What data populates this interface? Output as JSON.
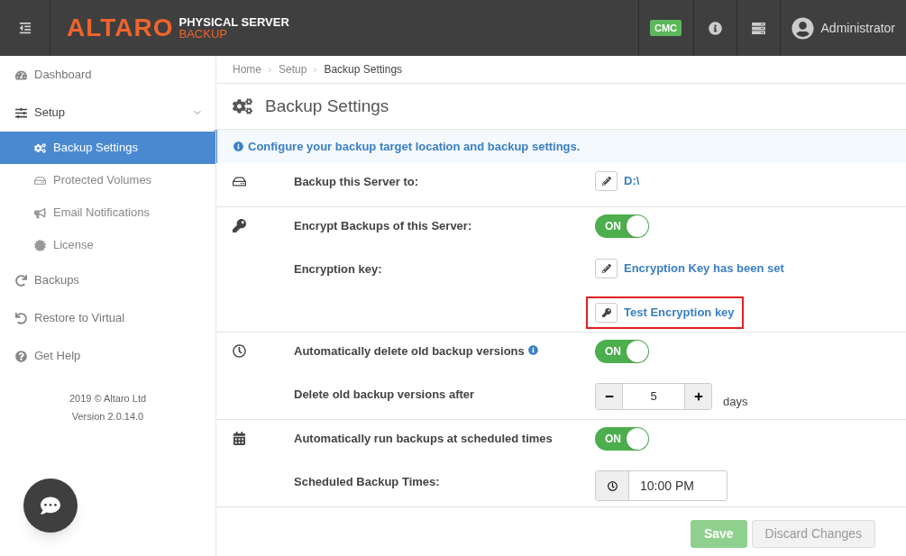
{
  "header": {
    "logo": {
      "wordmark": "ALTARO",
      "line_1": "PHYSICAL SERVER",
      "line_2": "BACKUP"
    },
    "badge": "CMC",
    "user": "Administrator"
  },
  "sidebar": {
    "items": [
      {
        "label": "Dashboard",
        "selected": false
      },
      {
        "label": "Setup",
        "selected": false,
        "expanded": true,
        "children": [
          {
            "label": "Backup Settings",
            "selected": true
          },
          {
            "label": "Protected Volumes",
            "selected": false
          },
          {
            "label": "Email Notifications",
            "selected": false
          },
          {
            "label": "License",
            "selected": false
          }
        ]
      },
      {
        "label": "Backups",
        "selected": false
      },
      {
        "label": "Restore to Virtual",
        "selected": false
      },
      {
        "label": "Get Help",
        "selected": false
      }
    ],
    "footer": [
      "2019 © Altaro Ltd",
      "Version 2.0.14.0"
    ]
  },
  "breadcrumb": [
    "Home",
    "Setup",
    "Backup Settings"
  ],
  "page_title": "Backup Settings",
  "info_message": "Configure your backup target location and backup settings.",
  "sections": [
    {
      "rows": [
        {
          "kind": "link",
          "label": "Backup this Server to:",
          "value": "D:\\",
          "highlighted": false
        }
      ]
    },
    {
      "rows": [
        {
          "kind": "toggle",
          "label": "Encrypt Backups of this Server:",
          "on": true,
          "state_label": "ON"
        },
        {
          "kind": "link",
          "label": "Encryption key:",
          "value": "Encryption Key has been set",
          "highlighted": false
        },
        {
          "kind": "key_link",
          "value": "Test Encryption key",
          "highlighted": true
        }
      ]
    },
    {
      "rows": [
        {
          "kind": "toggle",
          "label": "Automatically delete old backup versions",
          "info": true,
          "on": true,
          "state_label": "ON"
        },
        {
          "kind": "stepper",
          "label": "Delete old backup versions after",
          "value": "5",
          "unit": "days"
        }
      ]
    },
    {
      "rows": [
        {
          "kind": "toggle",
          "label": "Automatically run backups at scheduled times",
          "on": true,
          "state_label": "ON"
        },
        {
          "kind": "time",
          "label": "Scheduled Backup Times:",
          "value": "10:00 PM"
        }
      ]
    }
  ],
  "buttons": [
    {
      "label": "Save",
      "kind": "primary",
      "disabled": true
    },
    {
      "label": "Discard Changes",
      "kind": "secondary",
      "disabled": true
    }
  ]
}
